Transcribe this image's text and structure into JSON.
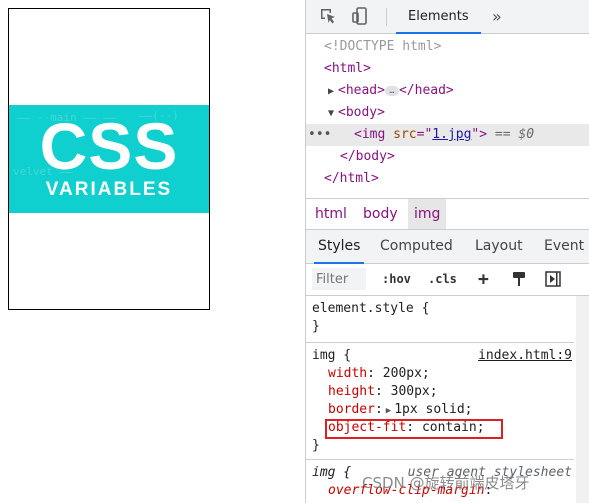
{
  "preview": {
    "image_title": "CSS",
    "image_subtitle": "VARIABLES"
  },
  "devtools": {
    "tabs": {
      "elements": "Elements",
      "more": "»"
    },
    "tree": {
      "doctype": "<!DOCTYPE html>",
      "html_open": "<html>",
      "head": {
        "open": "<head>",
        "ellipsis": "…",
        "close": "</head>"
      },
      "body_open": "<body>",
      "img": {
        "tag": "<img",
        "attr": "src",
        "eq": "=",
        "value": "1.jpg",
        "tag_end": ">",
        "marker": "== $0"
      },
      "body_close": "</body>",
      "html_close": "</html>",
      "dots": "•••"
    },
    "breadcrumbs": [
      "html",
      "body",
      "img"
    ],
    "subtabs": [
      "Styles",
      "Computed",
      "Layout",
      "Event L"
    ],
    "filter": {
      "placeholder": "Filter",
      "hov": ":hov",
      "cls": ".cls",
      "plus": "+"
    },
    "rules": {
      "element_style": {
        "selector": "element.style {",
        "close": "}"
      },
      "img_rule": {
        "selector": "img {",
        "source": "index.html:9",
        "declarations": [
          {
            "prop": "width",
            "value": "200px;"
          },
          {
            "prop": "height",
            "value": "300px;"
          },
          {
            "prop": "border",
            "value": "1px solid;"
          },
          {
            "prop": "object-fit",
            "value": "contain;"
          }
        ],
        "close": "}"
      },
      "ua_rule": {
        "selector": "img {",
        "source": "user agent stylesheet",
        "declarations": [
          {
            "prop": "overflow-clip-margin",
            "value": ""
          }
        ]
      }
    },
    "watermark": "CSDN @旋转前端皮塔牙"
  },
  "colors": {
    "accent": "#1a73e8",
    "tag": "#881280",
    "highlight": "#e02020",
    "image_bg": "#0fcfcf"
  }
}
